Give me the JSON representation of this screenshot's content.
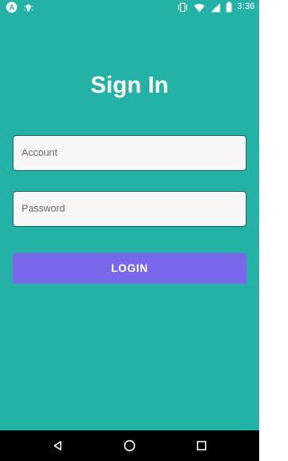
{
  "status_bar": {
    "time": "3:36",
    "left_icons": [
      "a-icon",
      "bug-icon"
    ],
    "right_icons": [
      "vibrate-icon",
      "wifi-icon",
      "signal-icon",
      "battery-icon"
    ]
  },
  "login_form": {
    "title": "Sign In",
    "account_placeholder": "Account",
    "password_placeholder": "Password",
    "login_label": "LOGIN"
  },
  "theme": {
    "background": "#24b1a6",
    "button": "#7a67ec",
    "input_background": "#f7f7f7",
    "text_primary": "#ffffff"
  },
  "nav_bar": {
    "buttons": [
      "back-icon",
      "home-icon",
      "recents-icon"
    ]
  }
}
